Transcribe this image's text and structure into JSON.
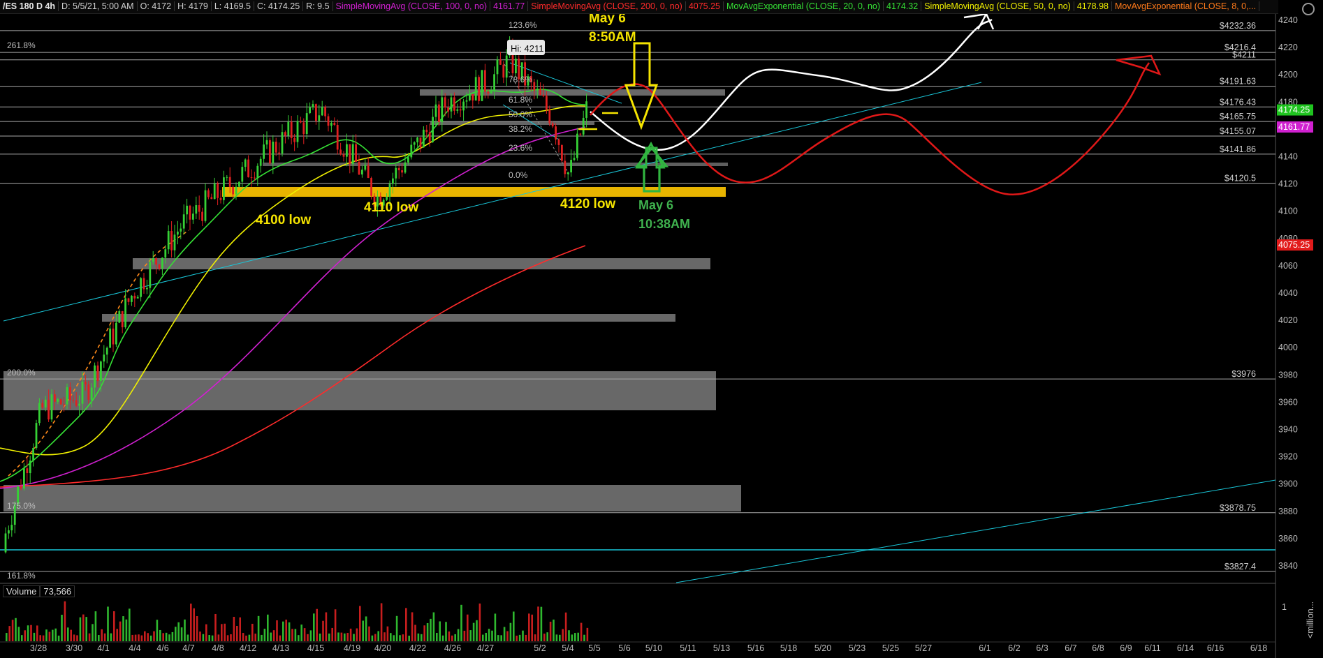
{
  "header": {
    "symbol": "/ES 180 D 4h",
    "date": "D: 5/5/21, 5:00 AM",
    "open": "O: 4172",
    "high": "H: 4179",
    "low": "L: 4169.5",
    "close": "C: 4174.25",
    "range": "R: 9.5",
    "studies": [
      {
        "label": "SimpleMovingAvg (CLOSE, 100, 0, no)",
        "value": "4161.77",
        "color": "#d020d0"
      },
      {
        "label": "SimpleMovingAvg (CLOSE, 200, 0, no)",
        "value": "4075.25",
        "color": "#ff2b2b"
      },
      {
        "label": "MovAvgExponential (CLOSE, 20, 0, no)",
        "value": "4174.32",
        "color": "#35e035"
      },
      {
        "label": "SimpleMovingAvg (CLOSE, 50, 0, no)",
        "value": "4178.98",
        "color": "#f0f000"
      },
      {
        "label": "MovAvgExponential (CLOSE, 8, 0,...",
        "value": "",
        "color": "#ff7a1a"
      }
    ]
  },
  "price_axis": {
    "ticks": [
      "4240",
      "4220",
      "4200",
      "4180",
      "4160",
      "4140",
      "4120",
      "4100",
      "4080",
      "4060",
      "4040",
      "4020",
      "4000",
      "3980",
      "3960",
      "3940",
      "3920",
      "3900",
      "3880",
      "3860",
      "3840"
    ],
    "badges": [
      {
        "text": "4174.25",
        "color": "#1fc41f"
      },
      {
        "text": "4161.77",
        "color": "#d020d0"
      },
      {
        "text": "4075.25",
        "color": "#e21b1b"
      }
    ]
  },
  "levels": [
    {
      "label": "$4232.36",
      "price": 4232.36
    },
    {
      "label": "$4216.4",
      "price": 4216.4
    },
    {
      "label": "$4211",
      "price": 4211
    },
    {
      "label": "$4191.63",
      "price": 4191.63
    },
    {
      "label": "$4176.43",
      "price": 4176.43
    },
    {
      "label": "$4165.75",
      "price": 4165.75
    },
    {
      "label": "$4155.07",
      "price": 4155.07
    },
    {
      "label": "$4141.86",
      "price": 4141.86
    },
    {
      "label": "$4120.5",
      "price": 4120.5
    },
    {
      "label": "$3976",
      "price": 3977
    },
    {
      "label": "$3878.75",
      "price": 3879
    },
    {
      "label": "$3827.4",
      "price": 3836
    }
  ],
  "fib_labels": [
    "261.8%",
    "200.0%",
    "175.0%",
    "161.8%",
    "123.6%",
    "78.6%",
    "61.8%",
    "50.0%",
    "38.2%",
    "23.6%",
    "0.0%"
  ],
  "hi_label": "Hi: 4211",
  "annotations": {
    "low_4100": "4100 low",
    "low_4110": "4110 low",
    "low_4120": "4120 low",
    "may6_top_date": "May 6",
    "may6_top_time": "8:50AM",
    "may6_bottom_date": "May 6",
    "may6_bottom_time": "10:38AM"
  },
  "x_axis": [
    "3/28",
    "3/30",
    "4/1",
    "4/4",
    "4/6",
    "4/7",
    "4/8",
    "4/12",
    "4/13",
    "4/15",
    "4/19",
    "4/20",
    "4/22",
    "4/26",
    "4/27",
    "5/2",
    "5/4",
    "5/5",
    "5/6",
    "5/10",
    "5/11",
    "5/13",
    "5/16",
    "5/18",
    "5/20",
    "5/23",
    "5/25",
    "5/27",
    "6/1",
    "6/2",
    "6/3",
    "6/7",
    "6/8",
    "6/9",
    "6/11",
    "6/14",
    "6/16",
    "6/18"
  ],
  "volume": {
    "label": "Volume",
    "value": "73,566",
    "scale_top": "1",
    "scale_unit": "<million..."
  }
}
